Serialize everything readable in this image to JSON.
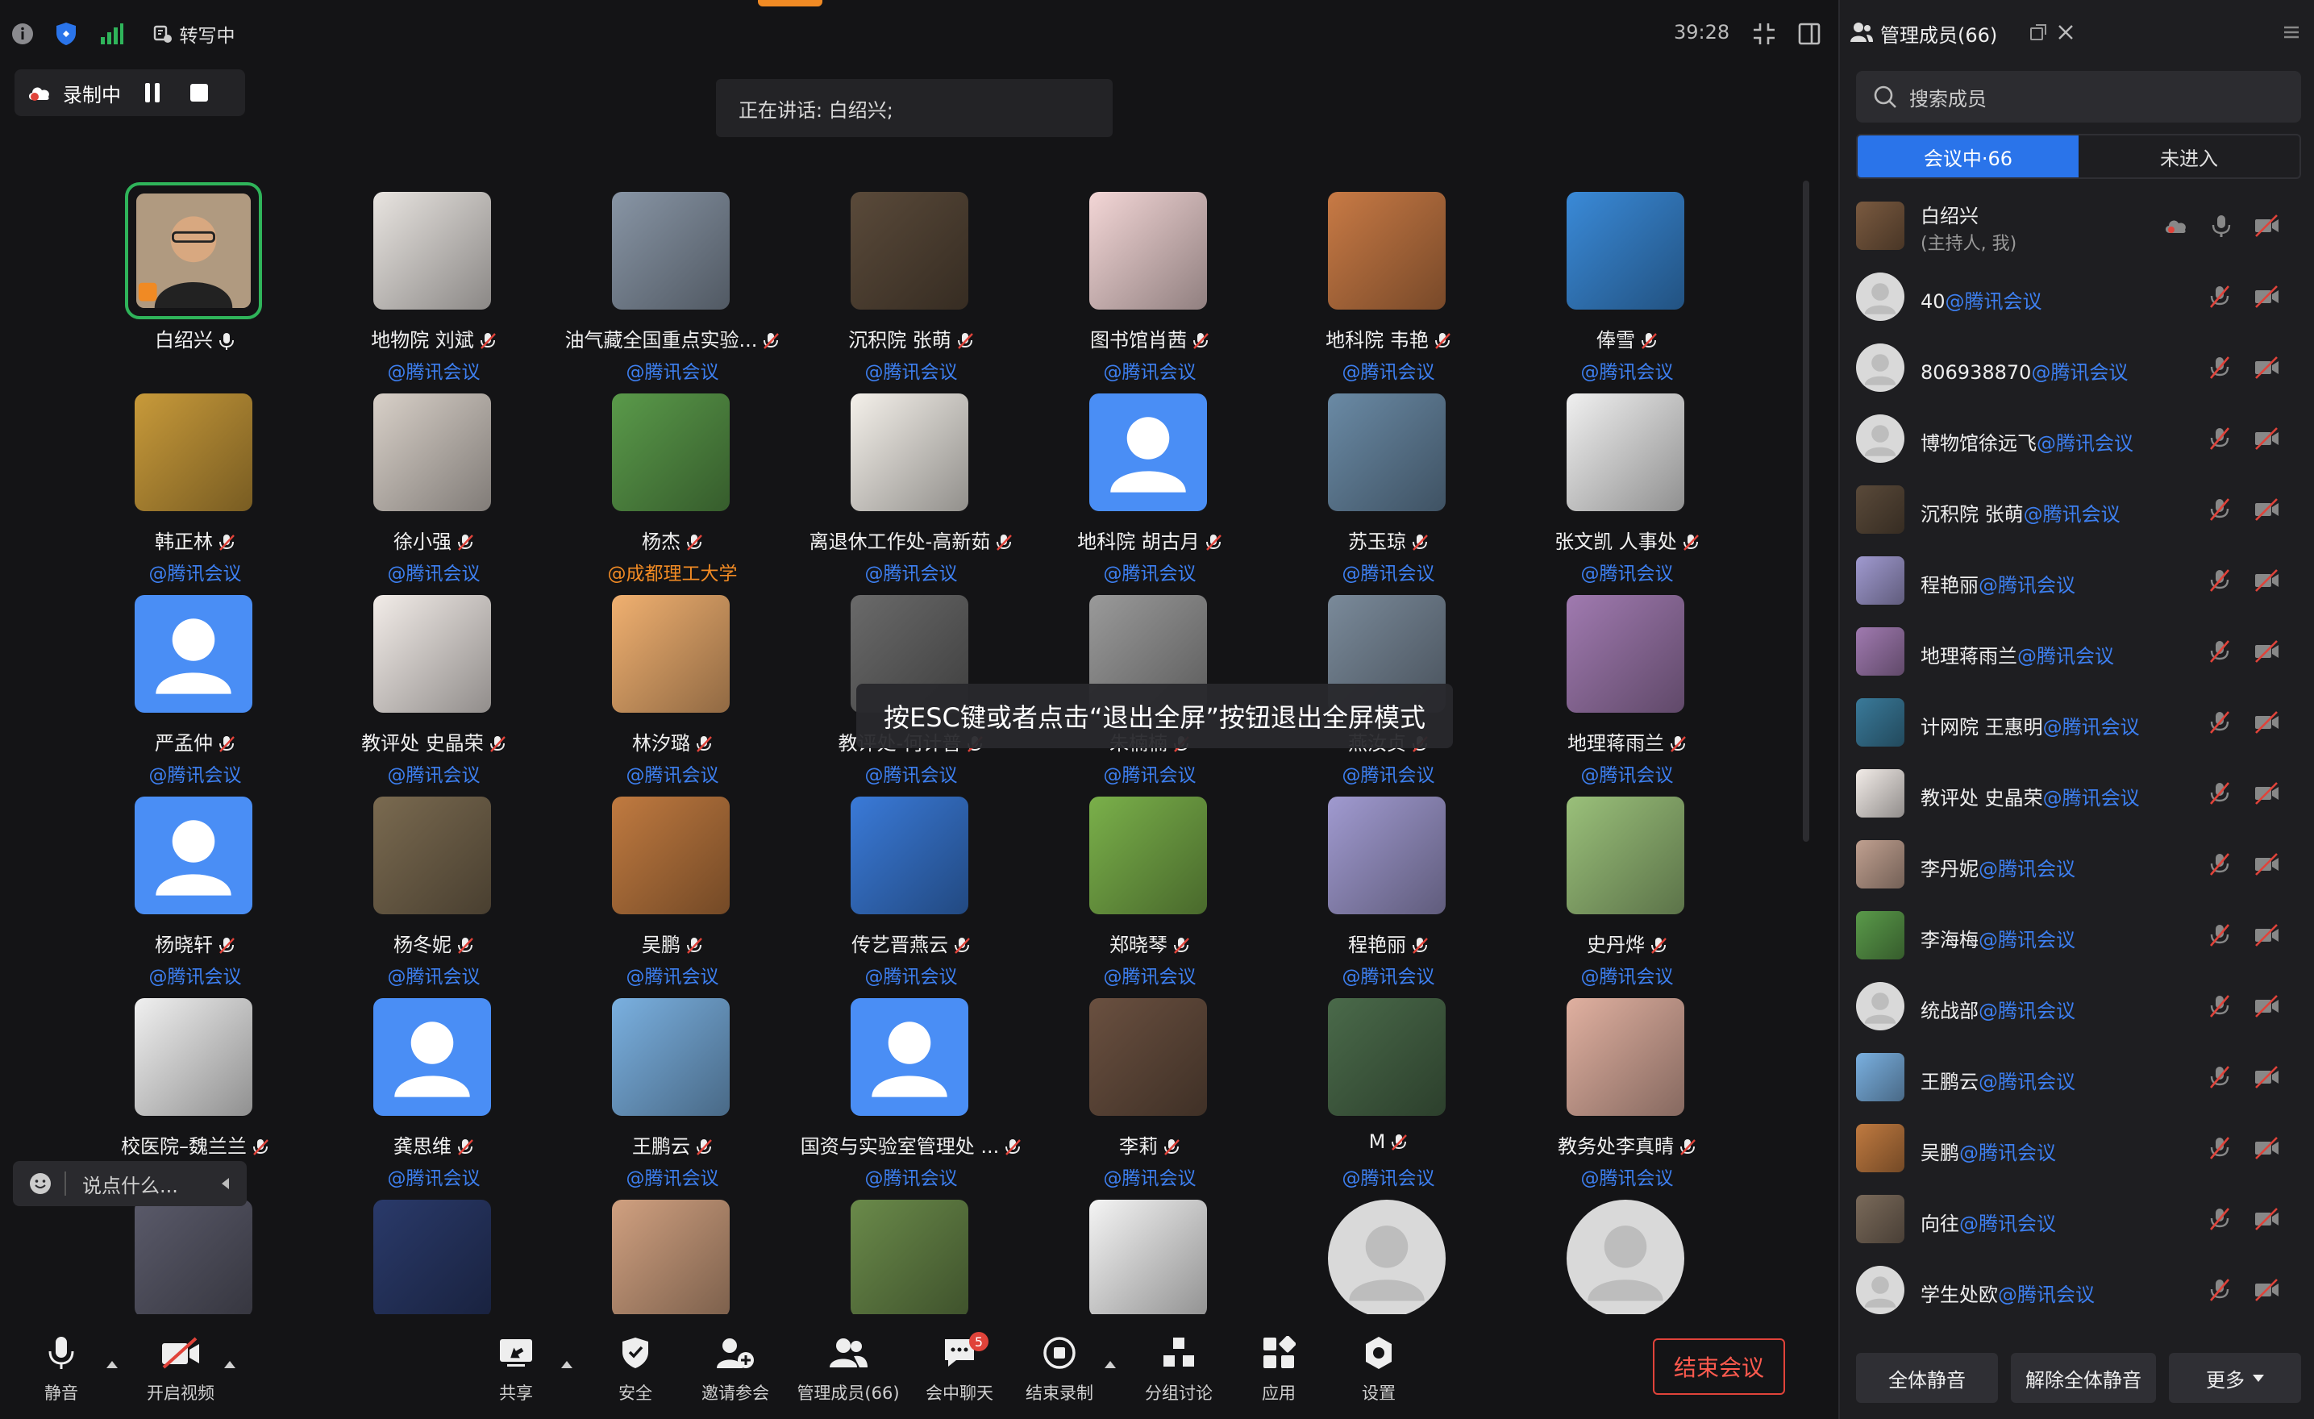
{
  "topbar": {
    "transcribe_label": "转写中",
    "timer": "39:28"
  },
  "recording": {
    "label": "录制中"
  },
  "speaker": {
    "text": "正在讲话: 白绍兴;"
  },
  "esc_tip": "按ESC键或者点击“退出全屏”按钮退出全屏模式",
  "chat_input": {
    "placeholder": "说点什么..."
  },
  "participants": [
    {
      "name": "白绍兴",
      "org": "",
      "host": true,
      "avatar_color": "#7a5a40"
    },
    {
      "name": "地物院 刘斌",
      "org": "@腾讯会议",
      "avatar_color": "#e8e4e0"
    },
    {
      "name": "油气藏全国重点实验...",
      "org": "@腾讯会议",
      "avatar_color": "#8895a5"
    },
    {
      "name": "沉积院 张萌",
      "org": "@腾讯会议",
      "avatar_color": "#5a4a3a"
    },
    {
      "name": "图书馆肖茜",
      "org": "@腾讯会议",
      "avatar_color": "#f3d6d6"
    },
    {
      "name": "地科院 韦艳",
      "org": "@腾讯会议",
      "avatar_color": "#c87a45"
    },
    {
      "name": "俸雪",
      "org": "@腾讯会议",
      "avatar_color": "#3a8ad8"
    },
    {
      "name": "韩正林",
      "org": "@腾讯会议",
      "avatar_color": "#c89a3a"
    },
    {
      "name": "徐小强",
      "org": "@腾讯会议",
      "avatar_color": "#d8d0c8"
    },
    {
      "name": "杨杰",
      "org": "@成都理工大学",
      "org_color": "orange",
      "avatar_color": "#5a9a4a"
    },
    {
      "name": "离退休工作处-高新茹",
      "org": "@腾讯会议",
      "avatar_color": "#f4f0ea"
    },
    {
      "name": "地科院 胡古月",
      "org": "@腾讯会议",
      "default": true
    },
    {
      "name": "苏玉琼",
      "org": "@腾讯会议",
      "avatar_color": "#6a8aa5"
    },
    {
      "name": "张文凯 人事处",
      "org": "@腾讯会议",
      "avatar_color": "#f0f0f0"
    },
    {
      "name": "严孟仲",
      "org": "@腾讯会议",
      "default": true
    },
    {
      "name": "教评处 史晶荣",
      "org": "@腾讯会议",
      "avatar_color": "#f2ece8"
    },
    {
      "name": "林汐璐",
      "org": "@腾讯会议",
      "avatar_color": "#f0b070"
    },
    {
      "name": "教评处-何计普",
      "org": "@腾讯会议",
      "avatar_color": "#6a6a6a"
    },
    {
      "name": "朱楠楠",
      "org": "@腾讯会议",
      "avatar_color": "#9a9a9a"
    },
    {
      "name": "燕汝贞",
      "org": "@腾讯会议",
      "avatar_color": "#7a8a9a"
    },
    {
      "name": "地理蒋雨兰",
      "org": "@腾讯会议",
      "avatar_color": "#a07ab0"
    },
    {
      "name": "杨晓轩",
      "org": "@腾讯会议",
      "default": true
    },
    {
      "name": "杨冬妮",
      "org": "@腾讯会议",
      "avatar_color": "#7a6a50"
    },
    {
      "name": "吴鹏",
      "org": "@腾讯会议",
      "avatar_color": "#c07a40"
    },
    {
      "name": "传艺晋燕云",
      "org": "@腾讯会议",
      "avatar_color": "#3a7ad8"
    },
    {
      "name": "郑晓琴",
      "org": "@腾讯会议",
      "avatar_color": "#7ab04a"
    },
    {
      "name": "程艳丽",
      "org": "@腾讯会议",
      "avatar_color": "#a09ad0"
    },
    {
      "name": "史丹烨",
      "org": "@腾讯会议",
      "avatar_color": "#9ac07a"
    },
    {
      "name": "校医院–魏兰兰",
      "org": "",
      "avatar_color": "#f0f0f0"
    },
    {
      "name": "龚思维",
      "org": "@腾讯会议",
      "default": true
    },
    {
      "name": "王鹏云",
      "org": "@腾讯会议",
      "avatar_color": "#7ab0e0"
    },
    {
      "name": "国资与实验室管理处 ...",
      "org": "@腾讯会议",
      "default": true
    },
    {
      "name": "李莉",
      "org": "@腾讯会议",
      "avatar_color": "#6a5040"
    },
    {
      "name": "M",
      "org": "@腾讯会议",
      "avatar_color": "#4a6a4a"
    },
    {
      "name": "教务处李真晴",
      "org": "@腾讯会议",
      "avatar_color": "#e0b0a0"
    },
    {
      "name": "",
      "org": "",
      "avatar_color": "#5a5a6a"
    },
    {
      "name": "",
      "org": "",
      "avatar_color": "#2a3a6a"
    },
    {
      "name": "",
      "org": "",
      "avatar_color": "#d0a080"
    },
    {
      "name": "",
      "org": "",
      "avatar_color": "#6a8a4a"
    },
    {
      "name": "",
      "org": "",
      "avatar_color": "#f4f4f4"
    },
    {
      "name": "",
      "org": "",
      "round": true
    },
    {
      "name": "",
      "org": "",
      "round": true
    }
  ],
  "toolbar": {
    "mute": "静音",
    "video": "开启视频",
    "share": "共享",
    "security": "安全",
    "invite": "邀请参会",
    "members": "管理成员(66)",
    "chat": "会中聊天",
    "chat_badge": "5",
    "record": "结束录制",
    "breakout": "分组讨论",
    "apps": "应用",
    "settings": "设置",
    "end": "结束会议"
  },
  "panel": {
    "title": "管理成员(66)",
    "search_placeholder": "搜索成员",
    "tab_in": "会议中·66",
    "tab_out": "未进入",
    "members": [
      {
        "name": "白绍兴",
        "sub": "(主持人, 我)",
        "org": "",
        "avatar_color": "#7a5a40"
      },
      {
        "name": "40",
        "org": "@腾讯会议",
        "round": true
      },
      {
        "name": "806938870",
        "org": "@腾讯会议",
        "round": true
      },
      {
        "name": "博物馆徐远飞",
        "org": "@腾讯会议",
        "round": true
      },
      {
        "name": "沉积院 张萌",
        "org": "@腾讯会议",
        "avatar_color": "#5a4a3a"
      },
      {
        "name": "程艳丽",
        "org": "@腾讯会议",
        "avatar_color": "#a09ad0"
      },
      {
        "name": "地理蒋雨兰",
        "org": "@腾讯会议",
        "avatar_color": "#a07ab0"
      },
      {
        "name": "计网院 王惠明",
        "org": "@腾讯会议",
        "avatar_color": "#3a7a9a"
      },
      {
        "name": "教评处 史晶荣",
        "org": "@腾讯会议",
        "avatar_color": "#f2ece8"
      },
      {
        "name": "李丹妮",
        "org": "@腾讯会议",
        "avatar_color": "#c0a090"
      },
      {
        "name": "李海梅",
        "org": "@腾讯会议",
        "avatar_color": "#5a9a4a"
      },
      {
        "name": "统战部",
        "org": "@腾讯会议",
        "round": true
      },
      {
        "name": "王鹏云",
        "org": "@腾讯会议",
        "avatar_color": "#7ab0e0"
      },
      {
        "name": "吴鹏",
        "org": "@腾讯会议",
        "avatar_color": "#c07a40"
      },
      {
        "name": "向往",
        "org": "@腾讯会议",
        "avatar_color": "#7a6a5a"
      },
      {
        "name": "学生处欧",
        "org": "@腾讯会议",
        "round": true
      }
    ],
    "mute_all": "全体静音",
    "unmute_all": "解除全体静音",
    "more": "更多"
  }
}
